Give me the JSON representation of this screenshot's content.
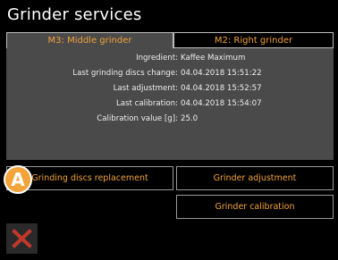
{
  "header": {
    "title": "Grinder services"
  },
  "tabs": [
    {
      "label": "M3: Middle grinder",
      "active": true
    },
    {
      "label": "M2: Right grinder",
      "active": false
    }
  ],
  "info": [
    {
      "label": "Ingredient:",
      "value": "Kaffee Maximum"
    },
    {
      "label": "Last grinding discs change:",
      "value": "04.04.2018 15:51:22"
    },
    {
      "label": "Last adjustment:",
      "value": "04.04.2018 15:52:57"
    },
    {
      "label": "Last calibration:",
      "value": "04.04.2018 15:54:07"
    },
    {
      "label": "Calibration value [g]:",
      "value": "25.0"
    }
  ],
  "buttons": {
    "discs_replacement": "Grinding discs replacement",
    "adjustment": "Grinder adjustment",
    "calibration": "Grinder calibration"
  },
  "annotation": {
    "badge": "A"
  },
  "colors": {
    "accent": "#f2a33a",
    "panel": "#4a4a4a",
    "close": "#c0392b"
  },
  "icons": {
    "close": "close-x-icon"
  }
}
